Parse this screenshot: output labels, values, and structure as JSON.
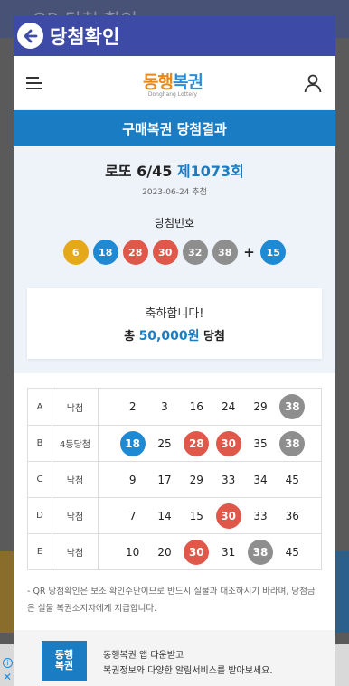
{
  "background": {
    "title": "QR 당첨 확인"
  },
  "dialog": {
    "title": "당첨확인"
  },
  "site": {
    "logo_main_a": "동행",
    "logo_main_b": "복권",
    "logo_sub": "Donghang Lottery"
  },
  "banner": "구매복권 당첨결과",
  "draw": {
    "game": "로또 6/45",
    "round": "제1073회",
    "date": "2023-06-24 추첨",
    "winning_label": "당첨번호",
    "winning_numbers": [
      "6",
      "18",
      "28",
      "30",
      "32",
      "38"
    ],
    "plus": "+",
    "bonus": "15"
  },
  "congrats": {
    "message": "축하합니다!",
    "prize_prefix": "총 ",
    "prize_amount": "50,000원",
    "prize_suffix": " 당첨"
  },
  "ticket": [
    {
      "letter": "A",
      "result": "낙첨",
      "numbers": [
        "2",
        "3",
        "16",
        "24",
        "29",
        "38"
      ]
    },
    {
      "letter": "B",
      "result": "4등당첨",
      "numbers": [
        "18",
        "25",
        "28",
        "30",
        "35",
        "38"
      ]
    },
    {
      "letter": "C",
      "result": "낙첨",
      "numbers": [
        "9",
        "17",
        "29",
        "33",
        "34",
        "45"
      ]
    },
    {
      "letter": "D",
      "result": "낙첨",
      "numbers": [
        "7",
        "14",
        "15",
        "30",
        "33",
        "36"
      ]
    },
    {
      "letter": "E",
      "result": "낙첨",
      "numbers": [
        "10",
        "20",
        "30",
        "31",
        "38",
        "45"
      ]
    }
  ],
  "notice": "- QR 당첨확인은 보조 확인수단이므로 반드시 실물과 대조하시기 바라며, 당첨금은 실물 복권소지자에게 지급합니다.",
  "app_promo": {
    "icon_text": "동행\n복권",
    "line1": "동행복권 앱 다운받고",
    "line2": "복권정보와 다양한 알림서비스를 받아보세요."
  },
  "ball_colors": {
    "yellow": "#e5a81b",
    "blue": "#1f8ad4",
    "red": "#e0584a",
    "gray": "#8e8e8e"
  },
  "colors": {
    "header": "#3d4ba6",
    "banner": "#1a7dc4"
  }
}
